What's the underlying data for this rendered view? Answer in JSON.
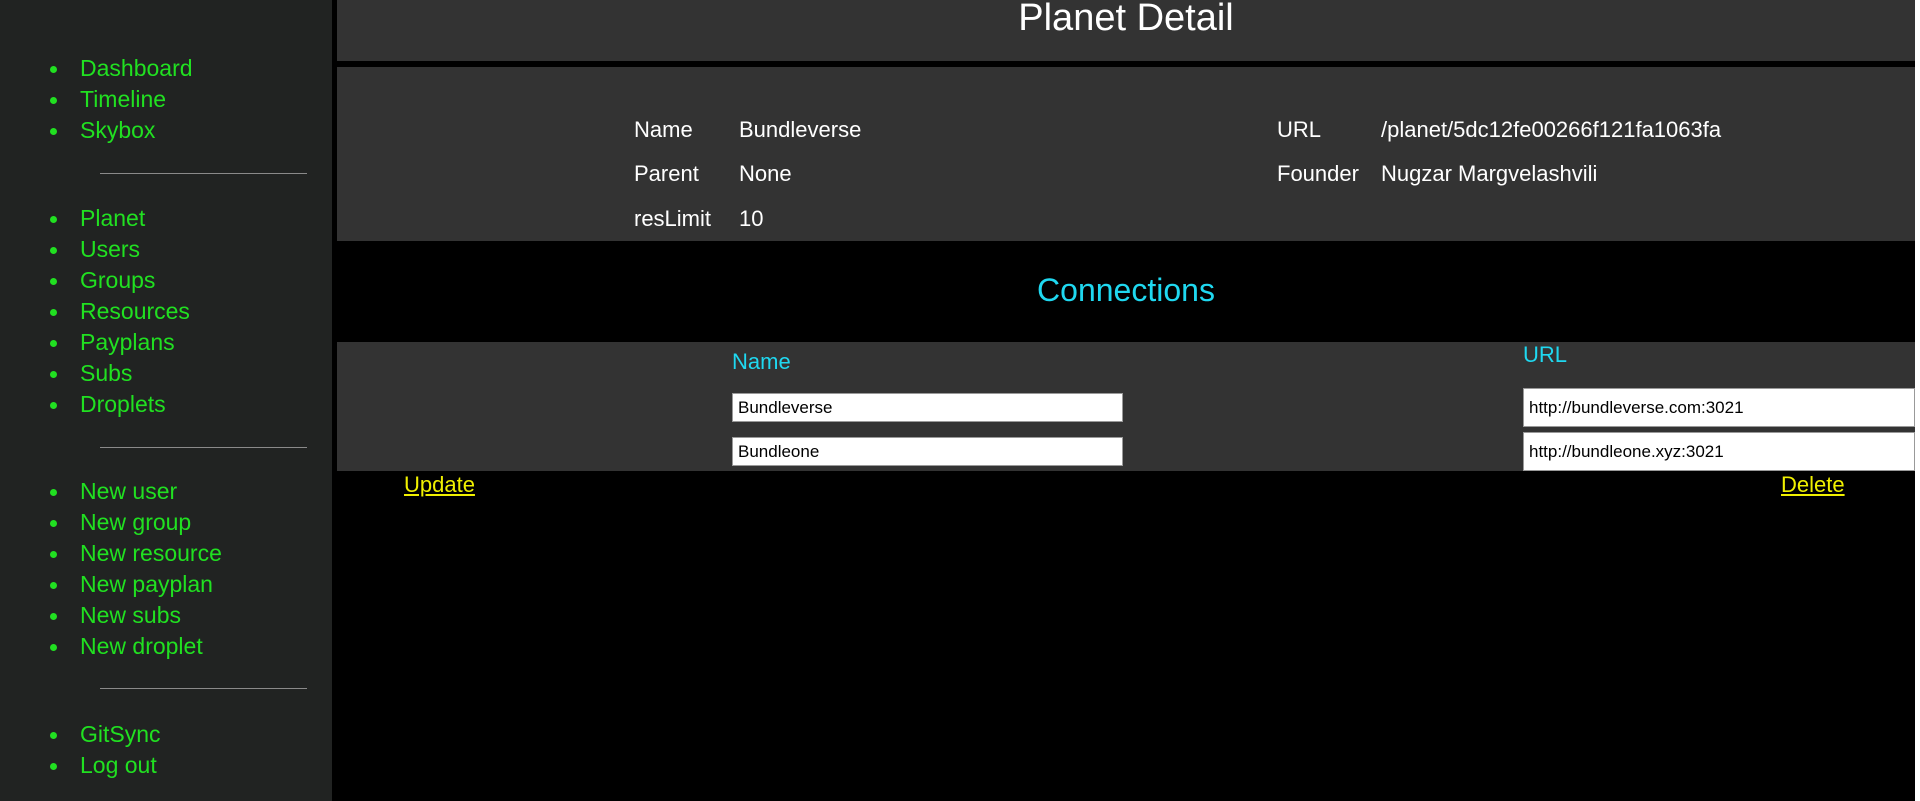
{
  "sidebar": {
    "group1": [
      "Dashboard",
      "Timeline",
      "Skybox"
    ],
    "group2": [
      "Planet",
      "Users",
      "Groups",
      "Resources",
      "Payplans",
      "Subs",
      "Droplets"
    ],
    "group3": [
      "New user",
      "New group",
      "New resource",
      "New payplan",
      "New subs",
      "New droplet"
    ],
    "group4": [
      "GitSync",
      "Log out"
    ]
  },
  "header": {
    "title": "Planet Detail"
  },
  "details": {
    "name_label": "Name",
    "name_value": "Bundleverse",
    "parent_label": "Parent",
    "parent_value": "None",
    "reslimit_label": "resLimit",
    "reslimit_value": "10",
    "url_label": "URL",
    "url_value": "/planet/5dc12fe00266f121fa1063fa",
    "founder_label": "Founder",
    "founder_value": "Nugzar Margvelashvili"
  },
  "connections": {
    "title": "Connections",
    "name_header": "Name",
    "url_header": "URL",
    "rows": [
      {
        "name": "Bundleverse",
        "url": "http://bundleverse.com:3021"
      },
      {
        "name": "Bundleone",
        "url": "http://bundleone.xyz:3021"
      }
    ]
  },
  "actions": {
    "update": "Update",
    "delete": "Delete"
  },
  "colors": {
    "link": "#21e021",
    "accent": "#1fd8f0",
    "action": "#f0f000",
    "panel": "#333333"
  }
}
